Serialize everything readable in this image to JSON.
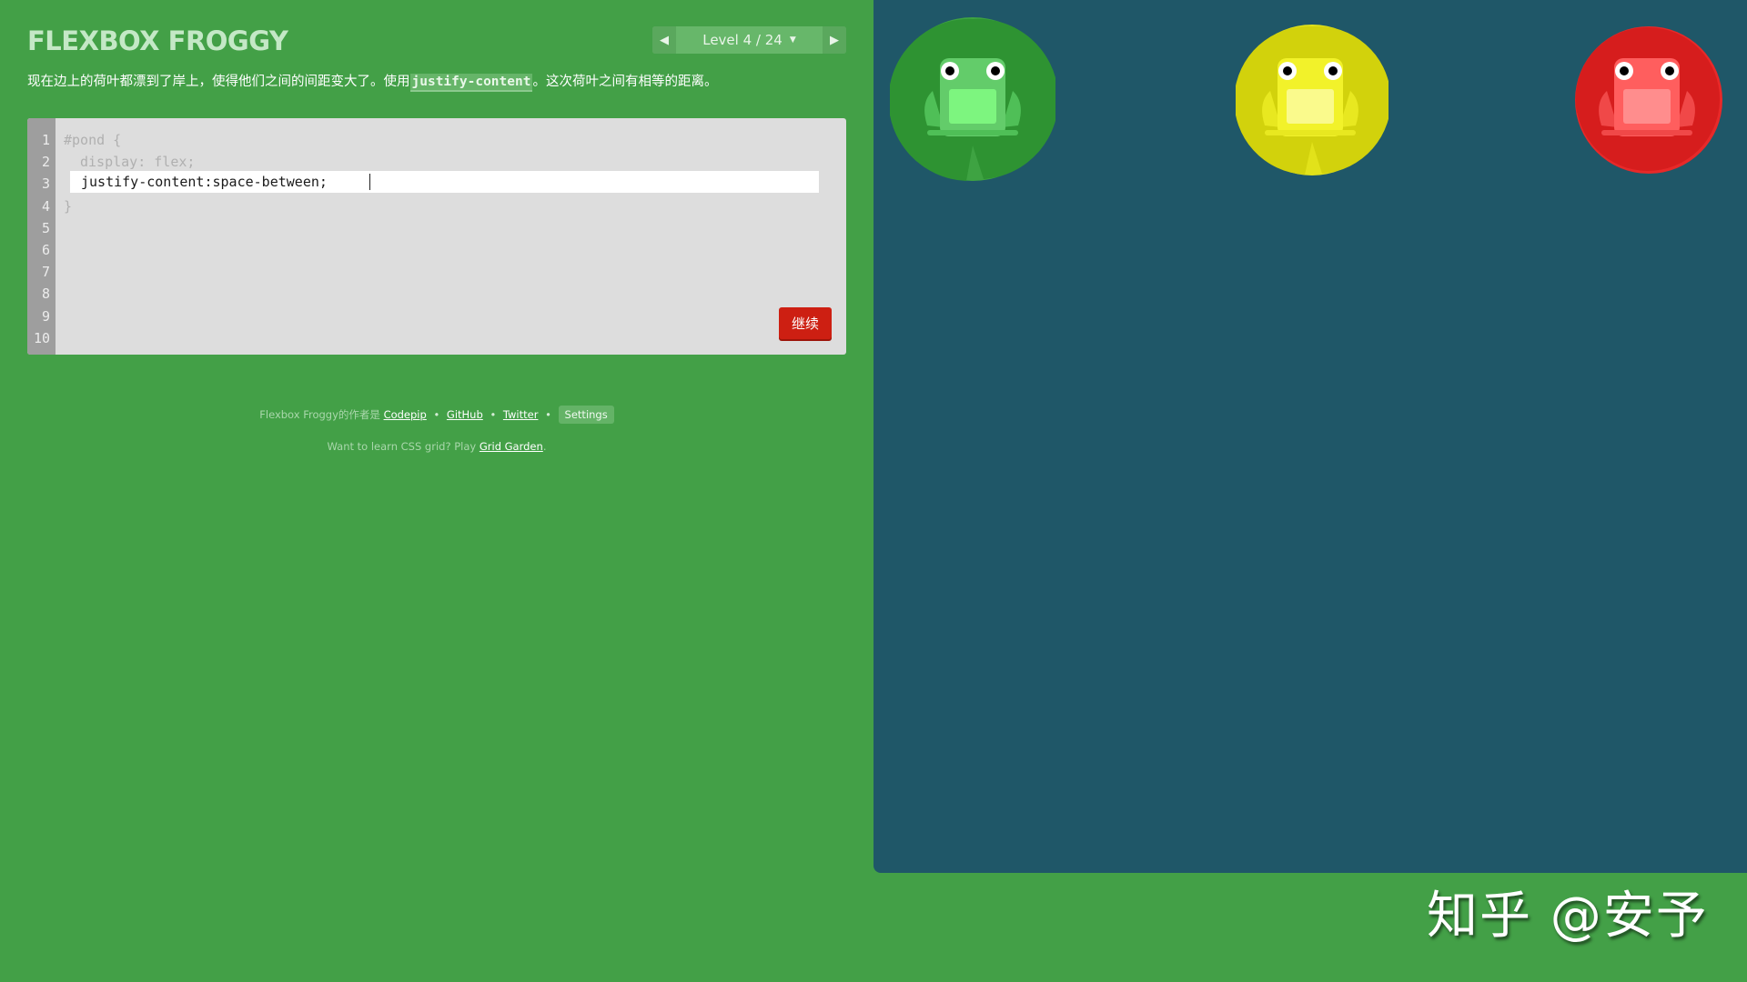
{
  "header": {
    "logo_text": "FLEXBOX FROGGY",
    "level_label": "Level 4 / 24",
    "prev_icon": "triangle-left-icon",
    "next_icon": "triangle-right-icon",
    "dropdown_icon": "caret-down-icon"
  },
  "instructions": {
    "before": "现在边上的荷叶都漂到了岸上，使得他们之间的间距变大了。使用",
    "code": "justify-content",
    "after": "。这次荷叶之间有相等的距离。"
  },
  "editor": {
    "line_numbers": [
      "1",
      "2",
      "3",
      "4",
      "5",
      "6",
      "7",
      "8",
      "9",
      "10"
    ],
    "line1": "#pond {",
    "line2": "display: flex;",
    "input_value": "justify-content:space-between;",
    "line4": "}",
    "next_button": "继续"
  },
  "footer": {
    "prefix": "Flexbox Froggy的作者是",
    "codepip": "Codepip",
    "github": "GitHub",
    "twitter": "Twitter",
    "settings": "Settings",
    "separator": "•",
    "grid_prefix": "Want to learn CSS grid? Play ",
    "grid_link": "Grid Garden",
    "grid_suffix": "."
  },
  "pond": {
    "frogs": [
      {
        "color": "green",
        "lilypad": "#2e9332",
        "lilypad_edge": "#3ea342",
        "body": "#63cc6a",
        "belly": "#7df57f"
      },
      {
        "color": "yellow",
        "lilypad": "#d2d20c",
        "lilypad_edge": "#e2e21a",
        "body": "#f2f22a",
        "belly": "#fafa8c"
      },
      {
        "color": "red",
        "lilypad": "#d61d1d",
        "lilypad_edge": "#e82929",
        "body": "#ff5e5e",
        "belly": "#ff8d8d"
      }
    ]
  },
  "watermark": "知乎 @安予"
}
